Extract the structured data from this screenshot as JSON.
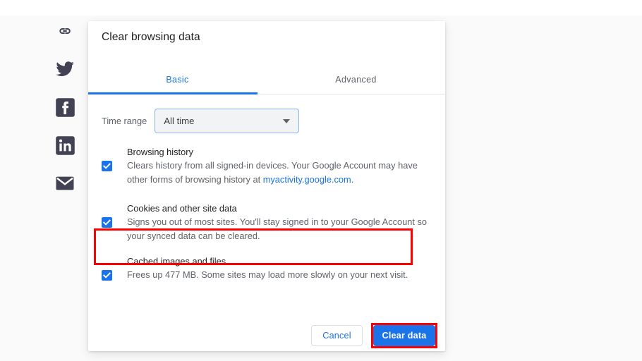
{
  "share_rail": {
    "items": [
      {
        "icon": "link-icon",
        "name": "share-link"
      },
      {
        "icon": "twitter-icon",
        "name": "share-twitter"
      },
      {
        "icon": "facebook-icon",
        "name": "share-facebook"
      },
      {
        "icon": "linkedin-icon",
        "name": "share-linkedin"
      },
      {
        "icon": "email-icon",
        "name": "share-email"
      }
    ]
  },
  "dialog": {
    "title": "Clear browsing data",
    "tabs": [
      {
        "label": "Basic",
        "active": true
      },
      {
        "label": "Advanced",
        "active": false
      }
    ],
    "time_range": {
      "label": "Time range",
      "value": "All time",
      "arrow_icon": "chevron-down-icon"
    },
    "options": [
      {
        "title": "Browsing history",
        "desc_before": "Clears history from all signed-in devices. Your Google Account may have other forms of browsing history at ",
        "link": "myactivity.google.com",
        "desc_after": ".",
        "checked": true
      },
      {
        "title": "Cookies and other site data",
        "desc_before": "Signs you out of most sites. You'll stay signed in to your Google Account so your synced data can be cleared.",
        "link": "",
        "desc_after": "",
        "checked": true
      },
      {
        "title": "Cached images and files",
        "desc_before": "Frees up 477 MB. Some sites may load more slowly on your next visit.",
        "link": "",
        "desc_after": "",
        "checked": true
      }
    ],
    "footer": {
      "cancel_label": "Cancel",
      "clear_label": "Clear data"
    }
  },
  "colors": {
    "accent_blue": "#1a73e8",
    "highlight_red": "#ff0000",
    "text_primary": "#202124",
    "text_secondary": "#5f6368",
    "page_bg": "#fafafa"
  }
}
